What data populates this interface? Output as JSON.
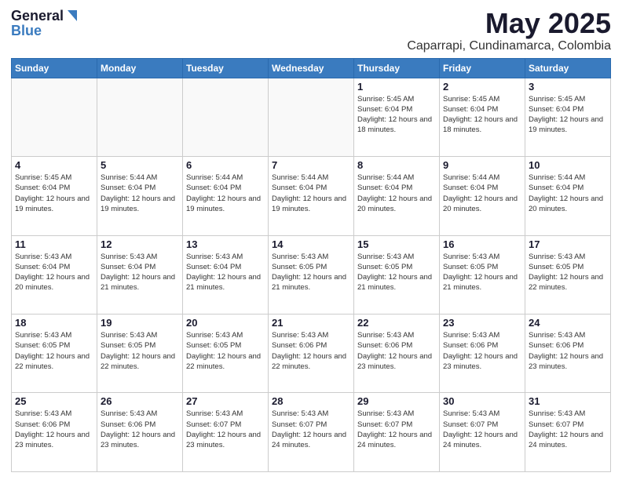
{
  "logo": {
    "line1": "General",
    "line2": "Blue"
  },
  "title": "May 2025",
  "location": "Caparrapi, Cundinamarca, Colombia",
  "days_of_week": [
    "Sunday",
    "Monday",
    "Tuesday",
    "Wednesday",
    "Thursday",
    "Friday",
    "Saturday"
  ],
  "weeks": [
    [
      {
        "day": "",
        "info": ""
      },
      {
        "day": "",
        "info": ""
      },
      {
        "day": "",
        "info": ""
      },
      {
        "day": "",
        "info": ""
      },
      {
        "day": "1",
        "info": "Sunrise: 5:45 AM\nSunset: 6:04 PM\nDaylight: 12 hours\nand 18 minutes."
      },
      {
        "day": "2",
        "info": "Sunrise: 5:45 AM\nSunset: 6:04 PM\nDaylight: 12 hours\nand 18 minutes."
      },
      {
        "day": "3",
        "info": "Sunrise: 5:45 AM\nSunset: 6:04 PM\nDaylight: 12 hours\nand 19 minutes."
      }
    ],
    [
      {
        "day": "4",
        "info": "Sunrise: 5:45 AM\nSunset: 6:04 PM\nDaylight: 12 hours\nand 19 minutes."
      },
      {
        "day": "5",
        "info": "Sunrise: 5:44 AM\nSunset: 6:04 PM\nDaylight: 12 hours\nand 19 minutes."
      },
      {
        "day": "6",
        "info": "Sunrise: 5:44 AM\nSunset: 6:04 PM\nDaylight: 12 hours\nand 19 minutes."
      },
      {
        "day": "7",
        "info": "Sunrise: 5:44 AM\nSunset: 6:04 PM\nDaylight: 12 hours\nand 19 minutes."
      },
      {
        "day": "8",
        "info": "Sunrise: 5:44 AM\nSunset: 6:04 PM\nDaylight: 12 hours\nand 20 minutes."
      },
      {
        "day": "9",
        "info": "Sunrise: 5:44 AM\nSunset: 6:04 PM\nDaylight: 12 hours\nand 20 minutes."
      },
      {
        "day": "10",
        "info": "Sunrise: 5:44 AM\nSunset: 6:04 PM\nDaylight: 12 hours\nand 20 minutes."
      }
    ],
    [
      {
        "day": "11",
        "info": "Sunrise: 5:43 AM\nSunset: 6:04 PM\nDaylight: 12 hours\nand 20 minutes."
      },
      {
        "day": "12",
        "info": "Sunrise: 5:43 AM\nSunset: 6:04 PM\nDaylight: 12 hours\nand 21 minutes."
      },
      {
        "day": "13",
        "info": "Sunrise: 5:43 AM\nSunset: 6:04 PM\nDaylight: 12 hours\nand 21 minutes."
      },
      {
        "day": "14",
        "info": "Sunrise: 5:43 AM\nSunset: 6:05 PM\nDaylight: 12 hours\nand 21 minutes."
      },
      {
        "day": "15",
        "info": "Sunrise: 5:43 AM\nSunset: 6:05 PM\nDaylight: 12 hours\nand 21 minutes."
      },
      {
        "day": "16",
        "info": "Sunrise: 5:43 AM\nSunset: 6:05 PM\nDaylight: 12 hours\nand 21 minutes."
      },
      {
        "day": "17",
        "info": "Sunrise: 5:43 AM\nSunset: 6:05 PM\nDaylight: 12 hours\nand 22 minutes."
      }
    ],
    [
      {
        "day": "18",
        "info": "Sunrise: 5:43 AM\nSunset: 6:05 PM\nDaylight: 12 hours\nand 22 minutes."
      },
      {
        "day": "19",
        "info": "Sunrise: 5:43 AM\nSunset: 6:05 PM\nDaylight: 12 hours\nand 22 minutes."
      },
      {
        "day": "20",
        "info": "Sunrise: 5:43 AM\nSunset: 6:05 PM\nDaylight: 12 hours\nand 22 minutes."
      },
      {
        "day": "21",
        "info": "Sunrise: 5:43 AM\nSunset: 6:06 PM\nDaylight: 12 hours\nand 22 minutes."
      },
      {
        "day": "22",
        "info": "Sunrise: 5:43 AM\nSunset: 6:06 PM\nDaylight: 12 hours\nand 23 minutes."
      },
      {
        "day": "23",
        "info": "Sunrise: 5:43 AM\nSunset: 6:06 PM\nDaylight: 12 hours\nand 23 minutes."
      },
      {
        "day": "24",
        "info": "Sunrise: 5:43 AM\nSunset: 6:06 PM\nDaylight: 12 hours\nand 23 minutes."
      }
    ],
    [
      {
        "day": "25",
        "info": "Sunrise: 5:43 AM\nSunset: 6:06 PM\nDaylight: 12 hours\nand 23 minutes."
      },
      {
        "day": "26",
        "info": "Sunrise: 5:43 AM\nSunset: 6:06 PM\nDaylight: 12 hours\nand 23 minutes."
      },
      {
        "day": "27",
        "info": "Sunrise: 5:43 AM\nSunset: 6:07 PM\nDaylight: 12 hours\nand 23 minutes."
      },
      {
        "day": "28",
        "info": "Sunrise: 5:43 AM\nSunset: 6:07 PM\nDaylight: 12 hours\nand 24 minutes."
      },
      {
        "day": "29",
        "info": "Sunrise: 5:43 AM\nSunset: 6:07 PM\nDaylight: 12 hours\nand 24 minutes."
      },
      {
        "day": "30",
        "info": "Sunrise: 5:43 AM\nSunset: 6:07 PM\nDaylight: 12 hours\nand 24 minutes."
      },
      {
        "day": "31",
        "info": "Sunrise: 5:43 AM\nSunset: 6:07 PM\nDaylight: 12 hours\nand 24 minutes."
      }
    ]
  ]
}
